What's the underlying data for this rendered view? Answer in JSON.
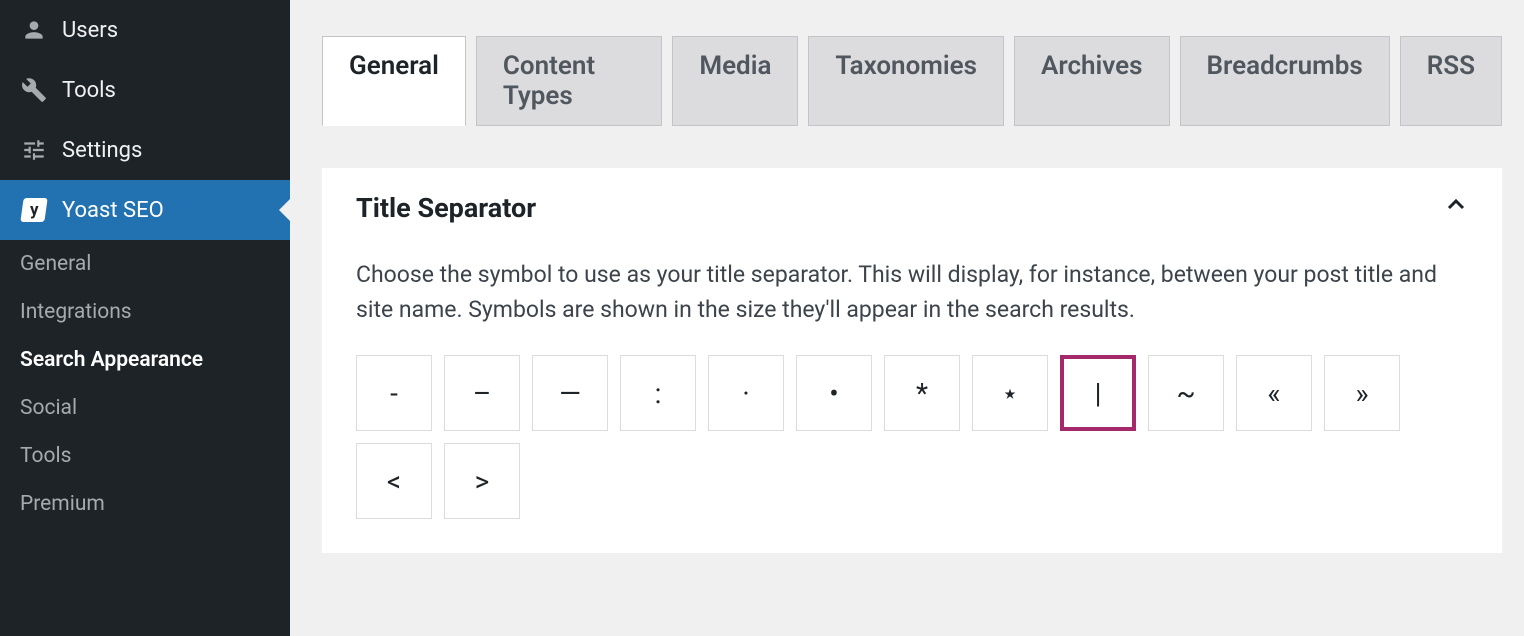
{
  "sidebar": {
    "items": [
      {
        "label": "Users",
        "icon": "users"
      },
      {
        "label": "Tools",
        "icon": "tools"
      },
      {
        "label": "Settings",
        "icon": "settings"
      },
      {
        "label": "Yoast SEO",
        "icon": "yoast"
      }
    ],
    "submenu": [
      {
        "label": "General"
      },
      {
        "label": "Integrations"
      },
      {
        "label": "Search Appearance"
      },
      {
        "label": "Social"
      },
      {
        "label": "Tools"
      },
      {
        "label": "Premium"
      }
    ]
  },
  "tabs": [
    {
      "label": "General"
    },
    {
      "label": "Content Types"
    },
    {
      "label": "Media"
    },
    {
      "label": "Taxonomies"
    },
    {
      "label": "Archives"
    },
    {
      "label": "Breadcrumbs"
    },
    {
      "label": "RSS"
    }
  ],
  "panel": {
    "title": "Title Separator",
    "description": "Choose the symbol to use as your title separator. This will display, for instance, between your post title and site name. Symbols are shown in the size they'll appear in the search results."
  },
  "separators": [
    {
      "symbol": "-",
      "name": "dash"
    },
    {
      "symbol": "–",
      "name": "ndash"
    },
    {
      "symbol": "—",
      "name": "mdash"
    },
    {
      "symbol": ":",
      "name": "colon"
    },
    {
      "symbol": "·",
      "name": "middot"
    },
    {
      "symbol": "•",
      "name": "bullet"
    },
    {
      "symbol": "*",
      "name": "asterisk"
    },
    {
      "symbol": "⋆",
      "name": "star"
    },
    {
      "symbol": "|",
      "name": "pipe"
    },
    {
      "symbol": "~",
      "name": "tilde"
    },
    {
      "symbol": "«",
      "name": "laquo"
    },
    {
      "symbol": "»",
      "name": "raquo"
    },
    {
      "symbol": "<",
      "name": "lt"
    },
    {
      "symbol": ">",
      "name": "gt"
    }
  ],
  "selected_separator_index": 8
}
